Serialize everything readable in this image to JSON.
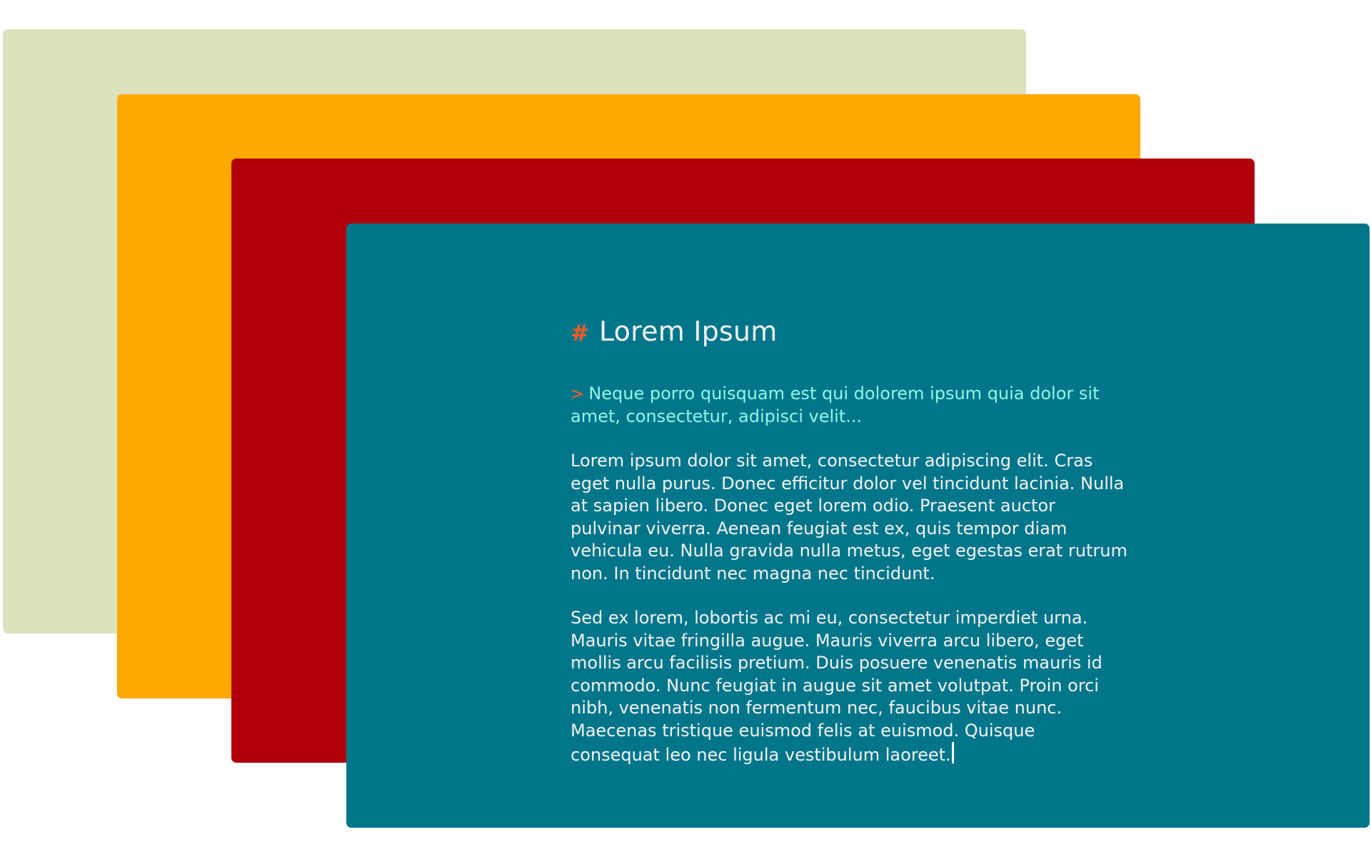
{
  "colors": {
    "card_back": "#dde2bd",
    "card_mid": "#ffa801",
    "card_front_behind": "#b0000c",
    "editor_background": "#01768b",
    "accent_orange": "#ff5a1f",
    "quote_text": "#8ff8e6",
    "body_text": "#f3f3f3"
  },
  "editor": {
    "heading_marker": "#",
    "heading": "Lorem Ipsum",
    "quote_marker": ">",
    "quote": "Neque porro quisquam est qui dolorem ipsum quia dolor sit amet, consectetur, adipisci velit...",
    "paragraphs": [
      "Lorem ipsum dolor sit amet, consectetur adipiscing elit. Cras eget nulla purus. Donec efficitur dolor vel tincidunt lacinia. Nulla at sapien libero. Donec eget lorem odio. Praesent auctor pulvinar viverra. Aenean feugiat est ex, quis tempor diam vehicula eu. Nulla gravida nulla metus, eget egestas erat rutrum non. In tincidunt nec magna nec tincidunt.",
      "Sed ex lorem, lobortis ac mi eu, consectetur imperdiet urna. Mauris vitae fringilla augue. Mauris viverra arcu libero, eget mollis arcu facilisis pretium. Duis posuere venenatis mauris id commodo. Nunc feugiat in augue sit amet volutpat. Proin orci nibh, venenatis non fermentum nec, faucibus vitae nunc. Maecenas tristique euismod felis at euismod. Quisque consequat leo nec ligula vestibulum laoreet."
    ]
  }
}
